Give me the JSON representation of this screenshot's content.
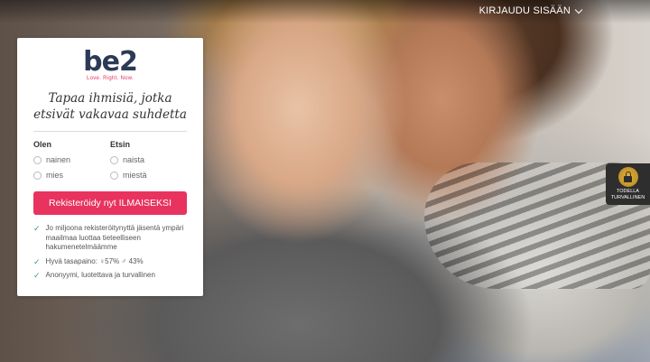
{
  "header": {
    "login_label": "KIRJAUDU SISÄÄN"
  },
  "brand": {
    "logo_text": "be2",
    "tagline": "Love. Right. Now.",
    "accent_color": "#e8335e"
  },
  "signup": {
    "headline": "Tapaa ihmisiä, jotka etsivät vakavaa suhdetta",
    "gender": {
      "label": "Olen",
      "options": [
        "nainen",
        "mies"
      ]
    },
    "seeking": {
      "label": "Etsin",
      "options": [
        "naista",
        "miestä"
      ]
    },
    "cta_label": "Rekisteröidy nyt ILMAISEKSI",
    "benefits": [
      "Jo miljoona rekisteröitynyttä jäsentä ympäri maailmaa luottaa tieteelliseen hakumenetelmäämme",
      "Hyvä tasapaino: ♀57% ♂ 43%",
      "Anonyymi, luotettava ja turvallinen"
    ]
  },
  "trust_badge": {
    "icon": "lock-icon",
    "line1": "TODELLA",
    "line2": "TURVALLINEN"
  }
}
